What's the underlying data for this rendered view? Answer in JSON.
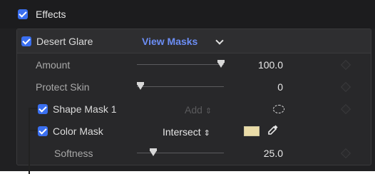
{
  "effects_header": {
    "label": "Effects",
    "checked": true
  },
  "effect": {
    "name": "Desert Glare",
    "checked": true,
    "view_masks_label": "View Masks",
    "params": {
      "amount": {
        "label": "Amount",
        "value": "100.0",
        "level": 1.0
      },
      "protect_skin": {
        "label": "Protect Skin",
        "value": "0",
        "level": 0.0
      },
      "softness": {
        "label": "Softness",
        "value": "25.0",
        "level": 0.25
      }
    },
    "shape_mask": {
      "label": "Shape Mask 1",
      "checked": true,
      "mode": "Add",
      "mode_icon": "updown-arrows-icon",
      "mode_disabled": true,
      "icon": "ellipse-mask-icon"
    },
    "color_mask": {
      "label": "Color Mask",
      "checked": true,
      "mode": "Intersect",
      "mode_icon": "updown-arrows-icon",
      "swatch_color": "#eadca8",
      "eyedropper_icon": "eyedropper-icon"
    }
  },
  "colors": {
    "accent": "#3a6ff0",
    "link": "#6c8ef5",
    "background": "#202022"
  }
}
